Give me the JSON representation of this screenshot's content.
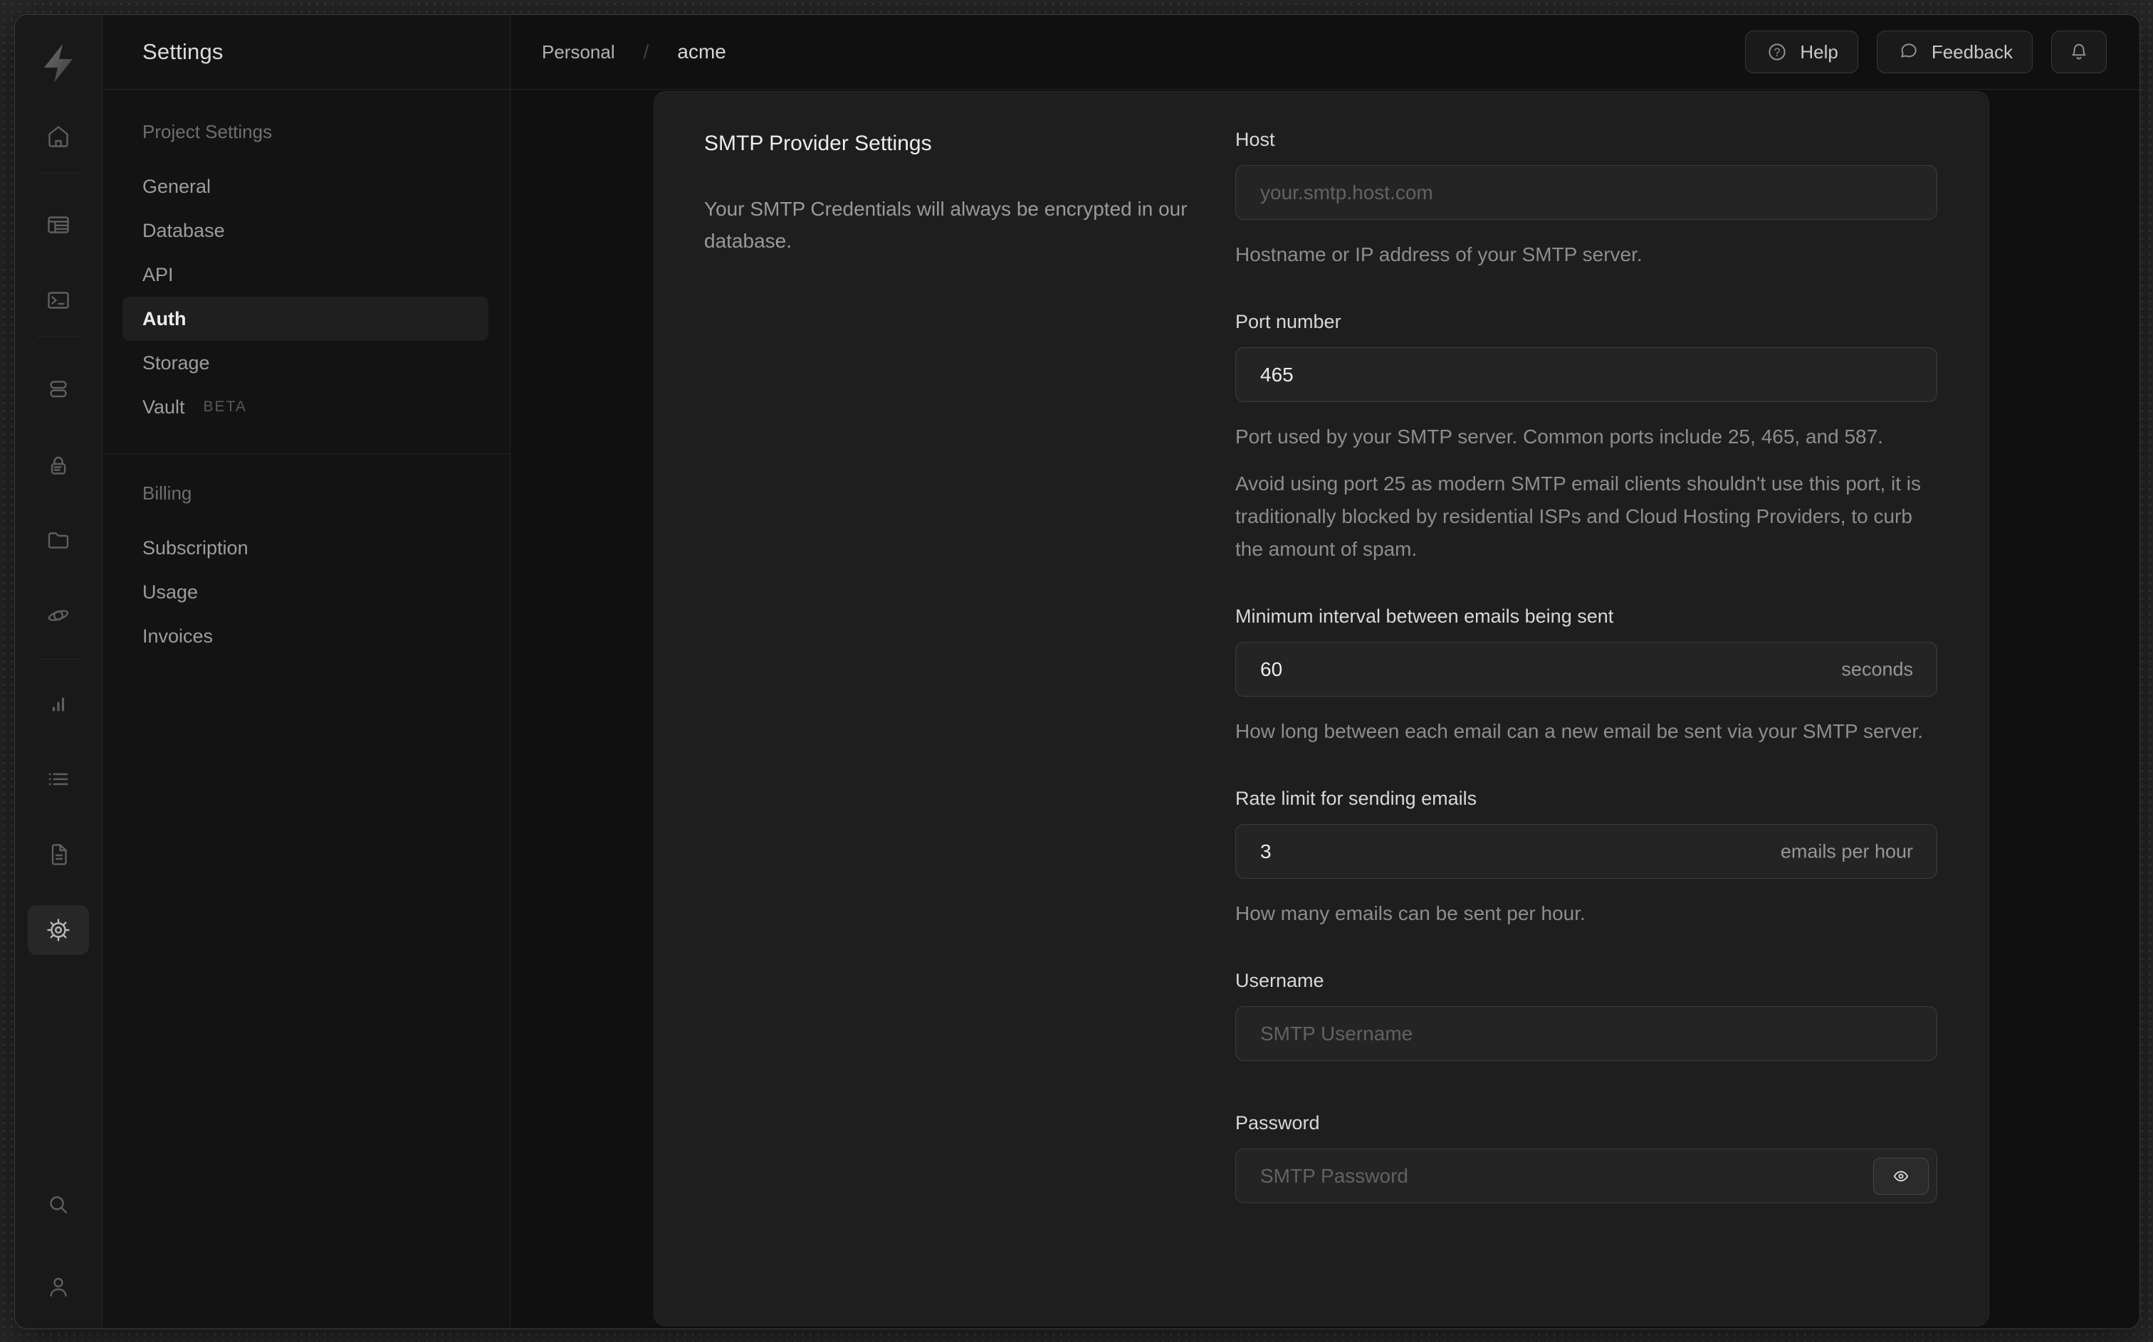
{
  "colors": {
    "wallpaper": "#272727",
    "window_bg": "#101010",
    "rail_bg": "#191919",
    "sidebar_bg": "#131313",
    "card_bg": "#1e1e1e",
    "input_bg": "#242424",
    "border": "#3c3c3c",
    "text_primary": "#ededed",
    "text_muted": "#8d8d8d"
  },
  "icon_rail": {
    "items": [
      "home",
      "table-editor",
      "sql-editor",
      "database",
      "auth",
      "storage",
      "edge-functions",
      "reports",
      "logs",
      "api-docs",
      "settings"
    ],
    "active_item": "settings",
    "bottom_items": [
      "search",
      "user"
    ]
  },
  "sidebar": {
    "title": "Settings",
    "sections": [
      {
        "title": "Project Settings",
        "items": [
          {
            "label": "General"
          },
          {
            "label": "Database"
          },
          {
            "label": "API"
          },
          {
            "label": "Auth",
            "active": true
          },
          {
            "label": "Storage"
          },
          {
            "label": "Vault",
            "badge": "BETA"
          }
        ]
      },
      {
        "title": "Billing",
        "items": [
          {
            "label": "Subscription"
          },
          {
            "label": "Usage"
          },
          {
            "label": "Invoices"
          }
        ]
      }
    ]
  },
  "header": {
    "breadcrumb": {
      "org": "Personal",
      "separator": "/",
      "project": "acme"
    },
    "help_label": "Help",
    "feedback_label": "Feedback"
  },
  "main": {
    "section_title": "SMTP Provider Settings",
    "section_description": "Your SMTP Credentials will always be encrypted in our database.",
    "fields": [
      {
        "label": "Host",
        "placeholder": "your.smtp.host.com",
        "helper": "Hostname or IP address of your SMTP server."
      },
      {
        "label": "Port number",
        "value": "465",
        "helper": "Port used by your SMTP server. Common ports include 25, 465, and 587.",
        "helper2": "Avoid using port 25 as modern SMTP email clients shouldn't use this port, it is traditionally blocked by residential ISPs and Cloud Hosting Providers, to curb the amount of spam."
      },
      {
        "label": "Minimum interval between emails being sent",
        "value": "60",
        "suffix": "seconds",
        "helper": "How long between each email can a new email be sent via your SMTP server."
      },
      {
        "label": "Rate limit for sending emails",
        "value": "3",
        "suffix": "emails per hour",
        "helper": "How many emails can be sent per hour."
      },
      {
        "label": "Username",
        "placeholder": "SMTP Username"
      },
      {
        "label": "Password",
        "placeholder": "SMTP Password"
      }
    ]
  }
}
